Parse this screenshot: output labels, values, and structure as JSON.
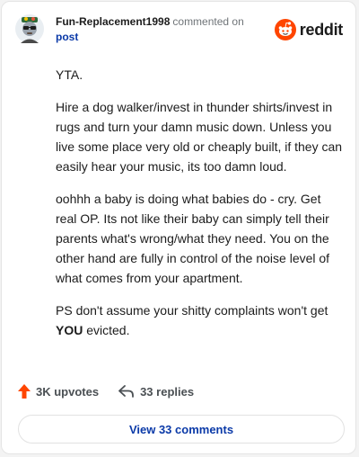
{
  "comment": {
    "username": "Fun-Replacement1998",
    "commented_on": "commented on",
    "post_label": "post",
    "paragraphs": [
      "YTA.",
      "Hire a dog walker/invest in thunder shirts/invest in rugs and turn your damn music down. Unless you live some place very old or cheaply built, if they can easily hear your music, its too damn loud.",
      "oohhh a baby is doing what babies do - cry. Get real OP. Its not like their baby can simply tell their parents what's wrong/what they need. You on the other hand are fully in control of the noise level of what comes from your apartment."
    ],
    "last_paragraph_before": "PS don't assume your shitty complaints won't get ",
    "last_paragraph_bold": "YOU",
    "last_paragraph_after": " evicted."
  },
  "brand": {
    "wordmark": "reddit",
    "icon": "reddit-alien-icon",
    "accent_color": "#ff4500"
  },
  "actions": {
    "upvotes_label": "3K upvotes",
    "replies_label": "33 replies",
    "upvote_icon": "upvote-arrow-icon",
    "reply_icon": "reply-arrow-icon",
    "upvote_color": "#ff4500"
  },
  "footer": {
    "view_comments_label": "View 33 comments",
    "link_color": "#0b3aa8"
  }
}
